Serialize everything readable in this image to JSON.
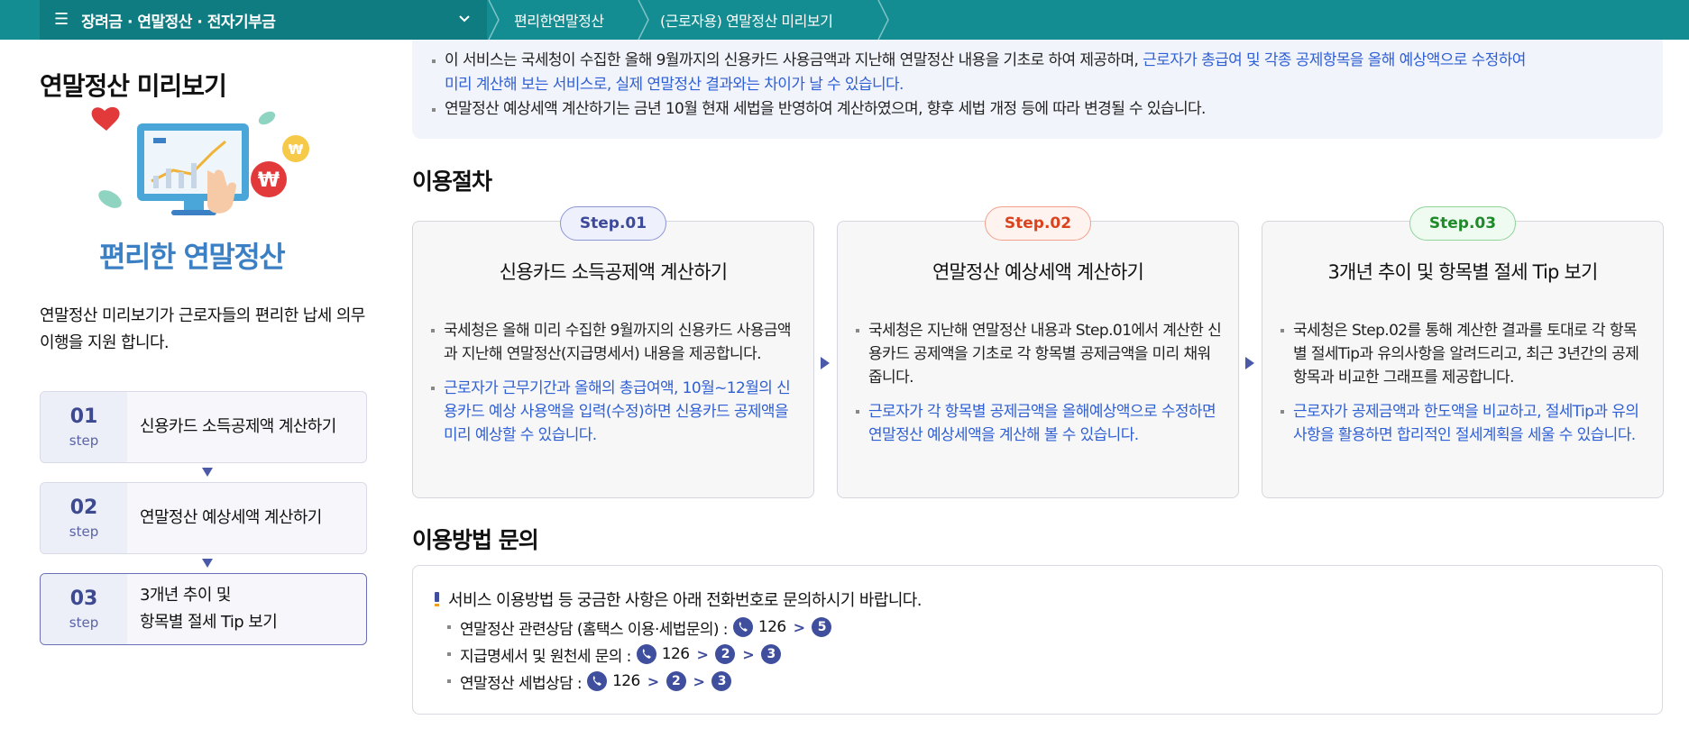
{
  "topbar": {
    "menu_title": "장려금 · 연말정산 · 전자기부금",
    "crumbs": [
      "편리한연말정산",
      "(근로자용) 연말정산 미리보기"
    ]
  },
  "left": {
    "title": "연말정산 미리보기",
    "hero_caption": "편리한 연말정산",
    "description": "연말정산 미리보기가 근로자들의  편리한 납세 의무 이행을 지원 합니다.",
    "steps": [
      {
        "num": "01",
        "step": "step",
        "label": "신용카드 소득공제액 계산하기"
      },
      {
        "num": "02",
        "step": "step",
        "label": "연말정산 예상세액 계산하기"
      },
      {
        "num": "03",
        "step": "step",
        "label_line1": "3개년 추이 및",
        "label_line2": "항목별 절세 Tip 보기"
      }
    ]
  },
  "notice": {
    "line1_plain": "이 서비스는 국세청이 수집한 올해 9월까지의 신용카드 사용금액과 지난해 연말정산 내용을 기초로 하여 제공하며, ",
    "line1_blue": "근로자가 총급여 및 각종 공제항목을 올해 예상액으로 수정하여",
    "line1_blue_cont": "미리 계산해 보는 서비스로, 실제 연말정산 결과와는 차이가 날 수 있습니다.",
    "line2": "연말정산 예상세액 계산하기는 금년 10월 현재 세법을 반영하여 계산하였으며, 향후 세법 개정 등에 따라 변경될 수 있습니다."
  },
  "procedure": {
    "title": "이용절차",
    "steps": [
      {
        "pill": "Step.01",
        "title": "신용카드 소득공제액 계산하기",
        "body": "국세청은 올해 미리 수집한 9월까지의 신용카드 사용금액과 지난해 연말정산(지급명세서) 내용을 제공합니다.",
        "note": "근로자가 근무기간과 올해의 총급여액, 10월~12월의 신용카드 예상 사용액을 입력(수정)하면 신용카드 공제액을 미리 예상할 수 있습니다."
      },
      {
        "pill": "Step.02",
        "title": "연말정산 예상세액 계산하기",
        "body": "국세청은 지난해 연말정산 내용과 Step.01에서 계산한 신용카드 공제액을 기초로 각 항목별 공제금액을 미리 채워줍니다.",
        "note": "근로자가 각 항목별 공제금액을 올해예상액으로 수정하면 연말정산 예상세액을 계산해 볼 수 있습니다."
      },
      {
        "pill": "Step.03",
        "title": "3개년 추이 및 항목별 절세 Tip 보기",
        "body": "국세청은 Step.02를 통해 계산한 결과를 토대로 각 항목별 절세Tip과 유의사항을 알려드리고, 최근 3년간의 공제항목과 비교한 그래프를 제공합니다.",
        "note": "근로자가 공제금액과 한도액을 비교하고, 절세Tip과 유의사항을 활용하면 합리적인 절세계획을 세울 수 있습니다."
      }
    ]
  },
  "inquiry": {
    "title": "이용방법 문의",
    "head": "서비스 이용방법 등 궁금한 사항은 아래 전화번호로 문의하시기 바랍니다.",
    "rows": [
      {
        "label": "연말정산 관련상담 (홈택스 이용·세법문의) :",
        "phone": "126",
        "keys": [
          "5"
        ]
      },
      {
        "label": "지급명세서 및 원천세 문의 :",
        "phone": "126",
        "keys": [
          "2",
          "3"
        ]
      },
      {
        "label": "연말정산 세법상담 :",
        "phone": "126",
        "keys": [
          "2",
          "3"
        ]
      }
    ]
  },
  "colors": {
    "topbar": "#138c92",
    "accent_blue": "#2f5fd4",
    "step1": "#3d4a9a",
    "step2": "#d9441e",
    "step3": "#1f8a2a"
  }
}
